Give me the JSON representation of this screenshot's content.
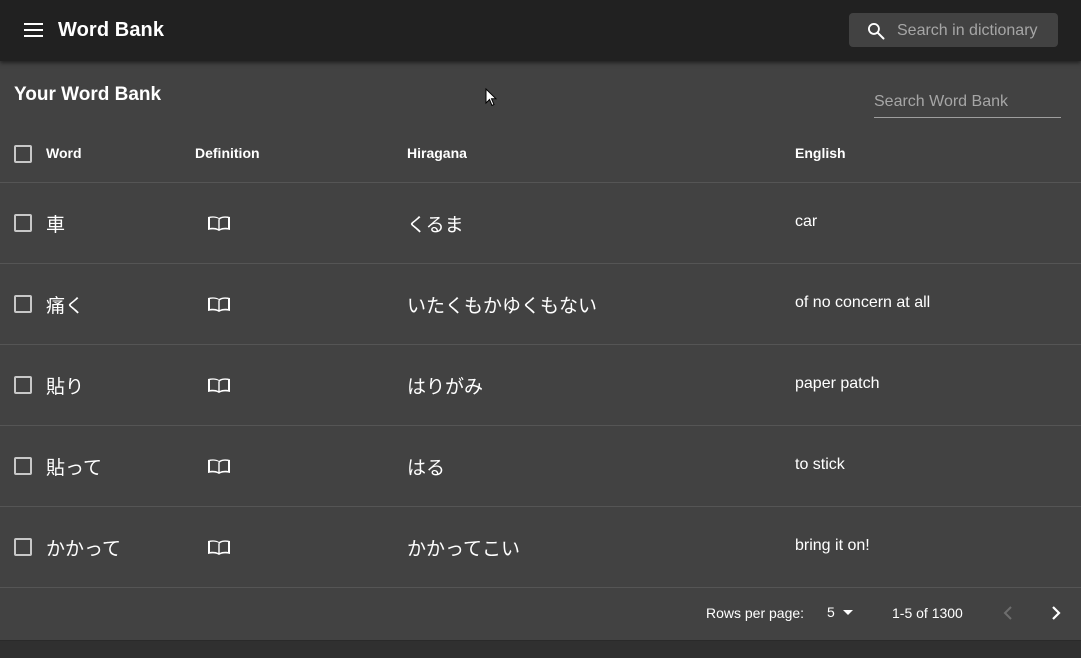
{
  "appbar": {
    "title": "Word Bank",
    "menu_icon": "menu-icon",
    "search": {
      "icon": "search-icon",
      "placeholder": "Search in dictionary"
    }
  },
  "word_bank": {
    "title": "Your Word Bank",
    "search_placeholder": "Search Word Bank",
    "columns": {
      "word": "Word",
      "definition": "Definition",
      "hiragana": "Hiragana",
      "english": "English"
    },
    "rows": [
      {
        "word": "車",
        "hiragana": "くるま",
        "english": "car"
      },
      {
        "word": "痛く",
        "hiragana": "いたくもかゆくもない",
        "english": "of no concern at all"
      },
      {
        "word": "貼り",
        "hiragana": "はりがみ",
        "english": "paper patch"
      },
      {
        "word": "貼って",
        "hiragana": "はる",
        "english": "to stick"
      },
      {
        "word": "かかって",
        "hiragana": "かかってこい",
        "english": "bring it on!"
      }
    ],
    "definition_icon": "book-open-icon"
  },
  "pagination": {
    "rows_per_page_label": "Rows per page:",
    "rows_per_page_value": "5",
    "range": "1-5 of 1300",
    "prev_icon": "chevron-left-icon",
    "next_icon": "chevron-right-icon"
  },
  "colors": {
    "appbar": "#212121",
    "background": "#303030",
    "panel": "#424242",
    "divider": "#555555",
    "text": "#ffffff",
    "muted_text": "#a6a6a6"
  }
}
